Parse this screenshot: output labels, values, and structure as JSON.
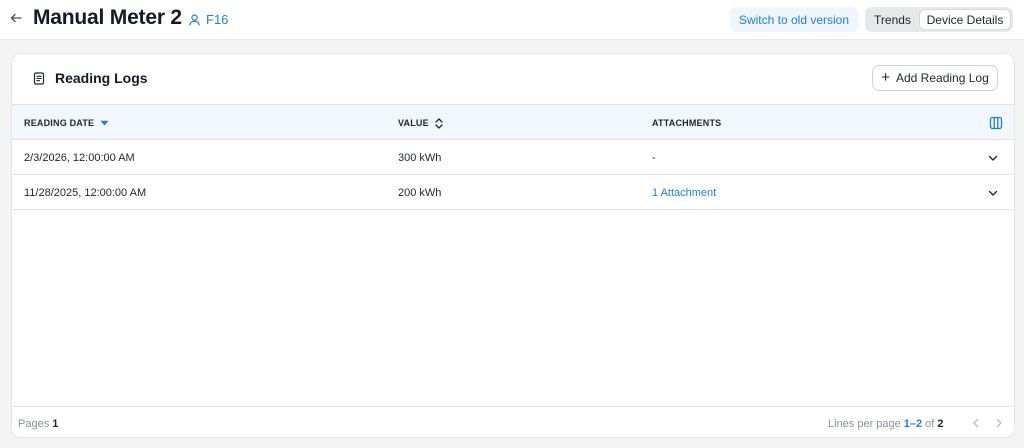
{
  "header": {
    "title": "Manual Meter 2",
    "location_label": "F16",
    "switch_label": "Switch to old version",
    "tabs": [
      {
        "label": "Trends",
        "active": false
      },
      {
        "label": "Device Details",
        "active": true
      }
    ]
  },
  "card": {
    "title": "Reading Logs",
    "add_label": "Add Reading Log",
    "columns": [
      "READING DATE",
      "VALUE",
      "ATTACHMENTS"
    ],
    "rows": [
      {
        "date": "2/3/2026, 12:00:00 AM",
        "value": "300 kWh",
        "attachments": "-"
      },
      {
        "date": "11/28/2025, 12:00:00 AM",
        "value": "200 kWh",
        "attachments": "1 Attachment"
      }
    ],
    "footer": {
      "pages_label": "Pages",
      "pages_value": "1",
      "lines_label": "Lines per page",
      "range": "1–2",
      "of_label": "of",
      "total": "2"
    }
  },
  "colors": {
    "accent": "#1f7fd6",
    "header_bg": "#f2f7fd"
  },
  "icons": [
    "back-arrow-icon",
    "location-pin-icon",
    "log-document-icon",
    "plus-icon",
    "sort-desc-icon",
    "sort-both-icon",
    "columns-icon",
    "chevron-down-icon",
    "chevron-left-icon",
    "chevron-right-icon"
  ]
}
